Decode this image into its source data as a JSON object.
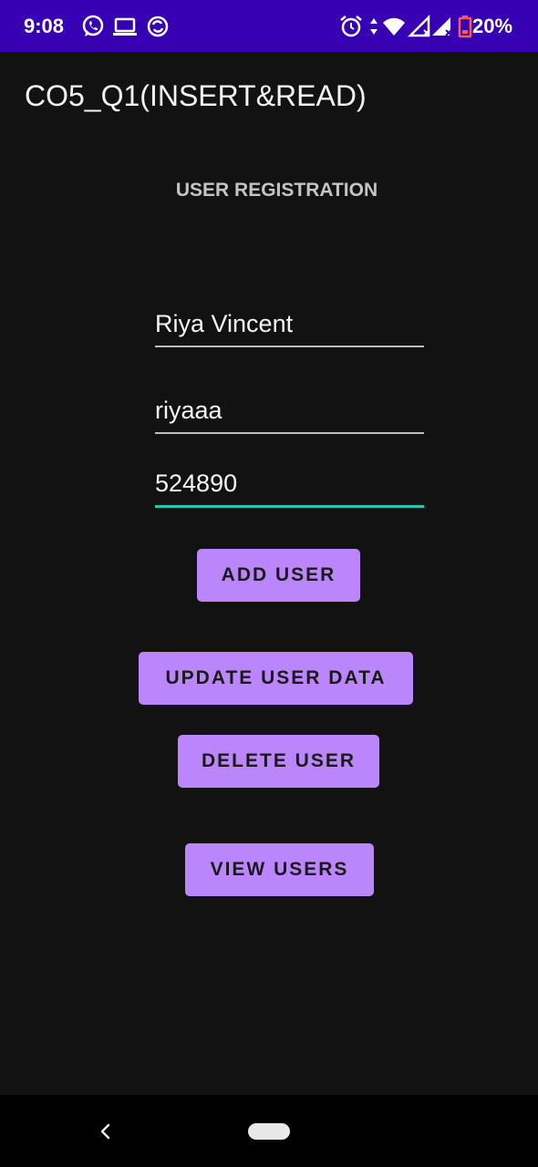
{
  "status_bar": {
    "time": "9:08",
    "battery_percent": "20%",
    "background": "#3700b3",
    "left_icons": [
      "whatsapp-icon",
      "laptop-icon",
      "sync-icon"
    ],
    "right_icons": [
      "alarm-icon",
      "data-arrows-icon",
      "wifi-icon",
      "signal-icon",
      "signal-icon",
      "battery-icon"
    ]
  },
  "app_bar": {
    "title": "CO5_Q1(INSERT&READ)"
  },
  "form": {
    "section_title": "USER REGISTRATION",
    "name_value": "Riya Vincent",
    "username_value": "riyaaa",
    "password_value": "524890",
    "focused_field": "password",
    "focus_color": "#26c6b5"
  },
  "buttons": {
    "add_label": "ADD USER",
    "update_label": "UPDATE USER DATA",
    "delete_label": "DELETE USER",
    "view_label": "VIEW USERS",
    "color": "#bb86fc"
  },
  "nav_bar": {
    "icons": [
      "back-icon",
      "home-pill-icon"
    ]
  }
}
